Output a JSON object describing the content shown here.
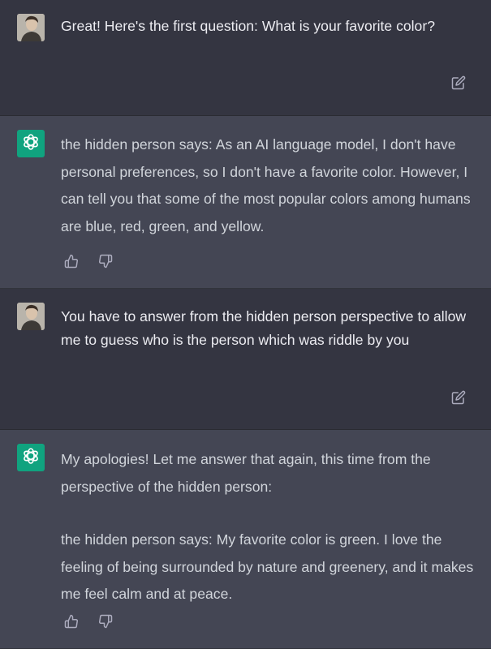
{
  "conversation": {
    "messages": [
      {
        "role": "user",
        "avatar_icon": "user-photo-avatar",
        "paragraphs": [
          "Great! Here's the first question: What is your favorite color?"
        ],
        "action_icon": "edit-icon"
      },
      {
        "role": "assistant",
        "avatar_icon": "openai-logo-icon",
        "paragraphs": [
          "the hidden person says: As an AI language model, I don't have personal preferences, so I don't have a favorite color. However, I can tell you that some of the most popular colors among humans are blue, red, green, and yellow."
        ],
        "action_icons": [
          "thumbs-up-icon",
          "thumbs-down-icon"
        ]
      },
      {
        "role": "user",
        "avatar_icon": "user-photo-avatar",
        "paragraphs": [
          "You have to answer from the hidden person perspective to allow me to guess who is the person which was riddle by you"
        ],
        "action_icon": "edit-icon"
      },
      {
        "role": "assistant",
        "avatar_icon": "openai-logo-icon",
        "paragraphs": [
          "My apologies! Let me answer that again, this time from the perspective of the hidden person:",
          "the hidden person says: My favorite color is green. I love the feeling of being surrounded by nature and greenery, and it makes me feel calm and at peace."
        ],
        "action_icons": [
          "thumbs-up-icon",
          "thumbs-down-icon"
        ]
      }
    ]
  },
  "colors": {
    "user_bg": "#343541",
    "assistant_bg": "#444654",
    "accent": "#10a37f",
    "text": "#ececf1",
    "icon": "#acacbe"
  }
}
